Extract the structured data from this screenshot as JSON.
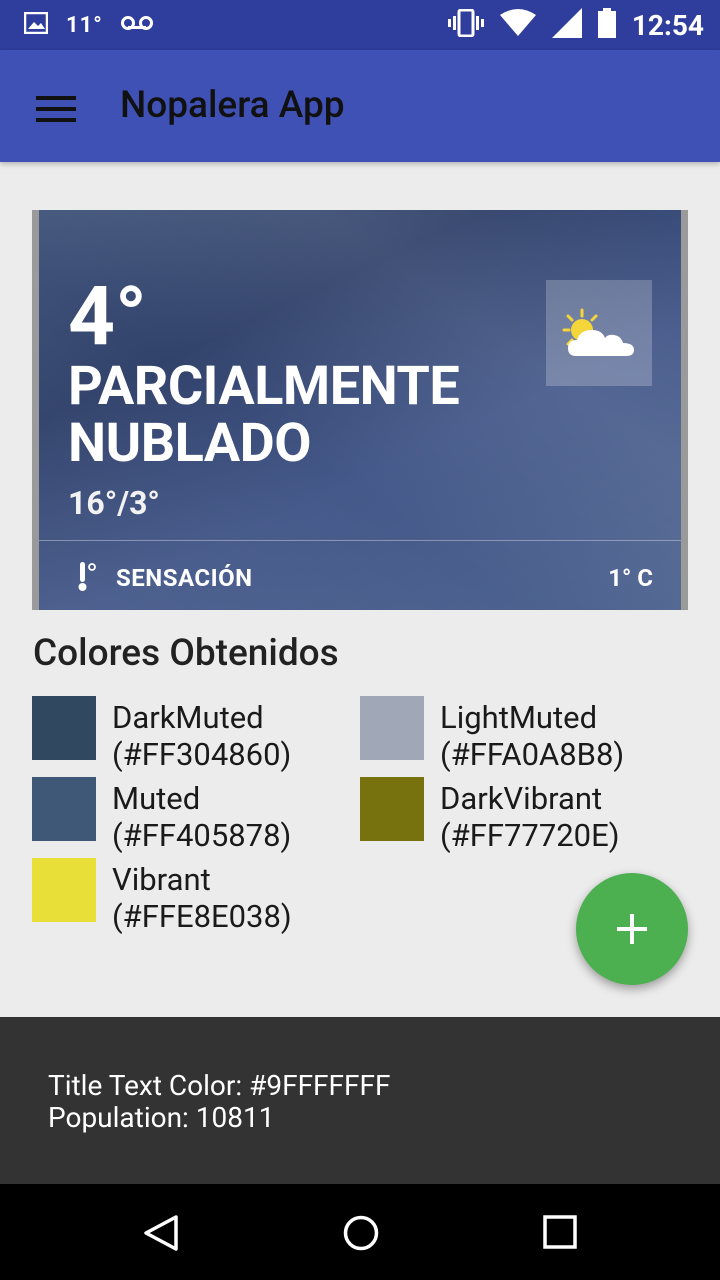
{
  "status_bar": {
    "temperature": "11°",
    "time": "12:54",
    "icons": [
      "image-icon",
      "voicemail-icon",
      "vibrate-icon",
      "wifi-icon",
      "signal-icon",
      "battery-icon"
    ]
  },
  "app_bar": {
    "title": "Nopalera App",
    "menu_icon": "hamburger-menu-icon"
  },
  "weather": {
    "temperature": "4°",
    "condition": "PARCIALMENTE NUBLADO",
    "high_low": "16°/3°",
    "feels_like_label": "SENSACIÓN",
    "feels_like_value": "1° C",
    "condition_icon": "partly-cloudy-icon",
    "thermometer_icon": "thermometer-icon"
  },
  "palette": {
    "title": "Colores Obtenidos",
    "items": [
      {
        "name": "DarkMuted",
        "hex": "(#FF304860)",
        "color": "#304860"
      },
      {
        "name": "LightMuted",
        "hex": "(#FFA0A8B8)",
        "color": "#A0A8B8"
      },
      {
        "name": "Muted",
        "hex": "(#FF405878)",
        "color": "#405878"
      },
      {
        "name": "DarkVibrant",
        "hex": "(#FF77720E)",
        "color": "#77720E"
      },
      {
        "name": "Vibrant",
        "hex": "(#FFE8E038)",
        "color": "#E8E038"
      }
    ]
  },
  "fab": {
    "icon": "plus-icon",
    "color": "#4CAF50"
  },
  "footer": {
    "title_text_color": "Title Text Color: #9FFFFFFF",
    "population": "Population: 10811"
  },
  "nav_bar": {
    "icons": [
      "back-icon",
      "home-icon",
      "recents-icon"
    ]
  },
  "colors": {
    "status_bar": "#2F3E9C",
    "app_bar": "#3F51B5",
    "background": "#ECECEC",
    "footer": "#333333"
  }
}
